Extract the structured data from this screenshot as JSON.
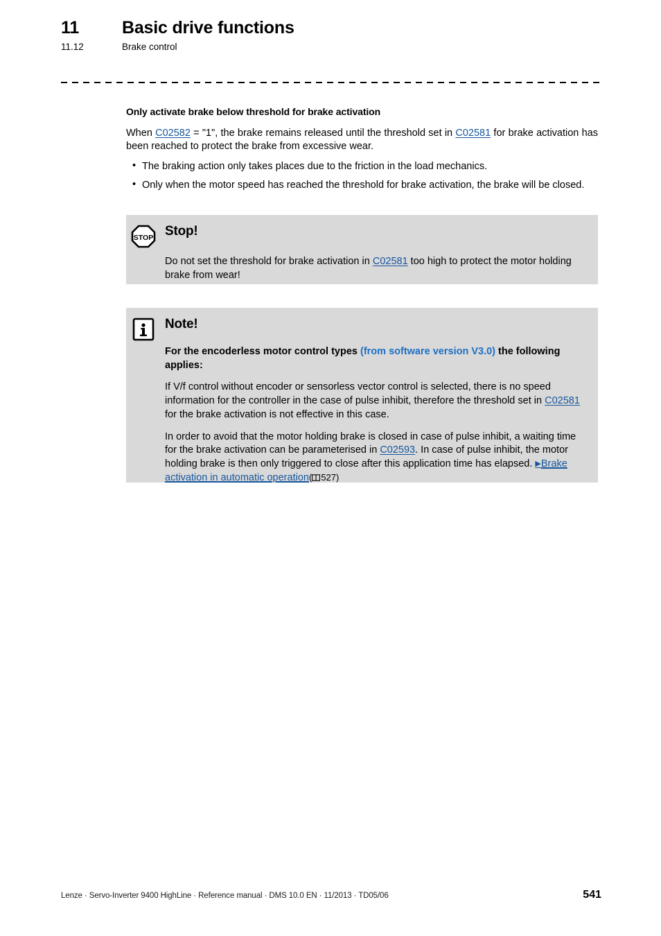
{
  "header": {
    "chapter_number": "11",
    "chapter_title": "Basic drive functions",
    "section_number": "11.12",
    "section_title": "Brake control"
  },
  "main": {
    "subheading": "Only activate brake below threshold for brake activation",
    "paragraph": {
      "part1": "When ",
      "link1": "C02582",
      "part2": " = \"1\", the brake remains released until the threshold set in ",
      "link2": "C02581",
      "part3": " for brake activation has been reached to protect the brake from excessive wear."
    },
    "bullets": [
      "The braking action only takes places due to the friction in the load mechanics.",
      "Only when the motor speed has reached the threshold for brake activation, the brake will be closed."
    ]
  },
  "callouts": {
    "stop": {
      "icon": "stop-sign-icon",
      "title": "Stop!",
      "text_part1": "Do not set the threshold for brake activation in ",
      "link": "C02581",
      "text_part2": " too high to protect the motor holding brake from wear!"
    },
    "note": {
      "icon": "info-icon",
      "title": "Note!",
      "bold_lead_part1": "For the encoderless motor control types ",
      "bold_lead_blue": "(from software version V3.0)",
      "bold_lead_part2": " the following applies:",
      "paragraph1_part1": "If V/f control without encoder or sensorless vector control is selected, there is no speed information for the controller in the case of pulse inhibit, therefore the threshold set in ",
      "paragraph1_link": "C02581",
      "paragraph1_part2": " for the brake activation is not effective in this case.",
      "paragraph2_part1": "In order to avoid that the motor holding brake is closed in case of pulse inhibit, a waiting time for the brake activation can be parameterised in ",
      "paragraph2_link": "C02593",
      "paragraph2_part2": ". In case of pulse inhibit, the motor holding brake is then only triggered to close after this application time has elapsed. ",
      "cross_reference": {
        "arrow": "▶",
        "label": "Brake activation in automatic operation",
        "page_open": "(",
        "page_number": "527",
        "page_close": ")"
      }
    }
  },
  "footer": {
    "imprint": "Lenze · Servo-Inverter 9400 HighLine · Reference manual · DMS 10.0 EN · 11/2013 · TD05/06",
    "page_number": "541"
  },
  "colors": {
    "link": "#15559c",
    "accent_blue": "#1f6fc4",
    "callout_background": "#d9d9d9"
  }
}
